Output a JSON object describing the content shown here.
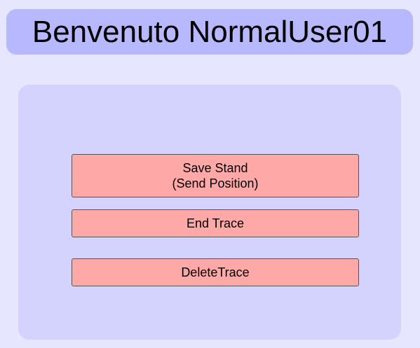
{
  "header": {
    "title": "Benvenuto NormalUser01"
  },
  "actions": {
    "save_stand_line1": "Save Stand",
    "save_stand_line2": "(Send Position)",
    "end_trace": "End Trace",
    "delete_trace": "DeleteTrace"
  },
  "colors": {
    "page_background": "#e6e6fe",
    "header_background": "#b8b8fe",
    "panel_background": "#d3d3fe",
    "button_background": "#fea8a8"
  }
}
